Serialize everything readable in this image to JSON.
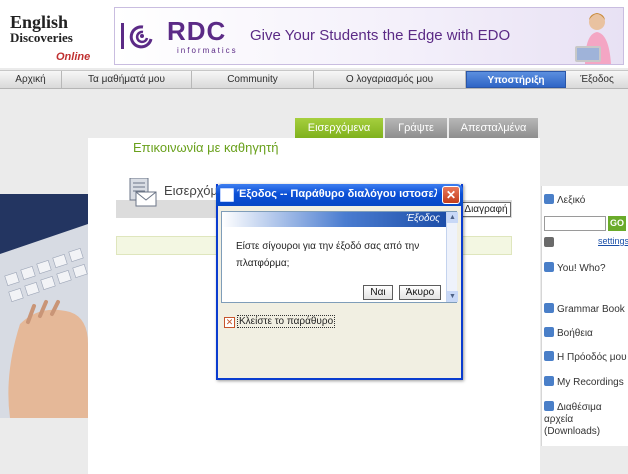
{
  "header": {
    "logo": {
      "line1": "English",
      "line2": "Discoveries",
      "online": "Online"
    },
    "banner": {
      "brand": "RDC",
      "brand_sub": "informatics",
      "slogan": "Give Your Students the Edge with EDO"
    }
  },
  "nav": {
    "items": [
      "Αρχική",
      "Τα μαθήματά μου",
      "Community",
      "Ο λογαριασμός μου",
      "Υποστήριξη",
      "Έξοδος"
    ],
    "active_index": 4
  },
  "tabs": [
    "Εισερχόμενα",
    "Γράψτε",
    "Απεσταλμένα"
  ],
  "page_title": "Επικοινωνία με καθηγητή",
  "inbox": {
    "label": "Εισερχόμενα",
    "delete_label": "Διαγραφή"
  },
  "sidebar": {
    "dictionary": "Λεξικό",
    "go": "GO",
    "settings": "settings",
    "you_who": "You! Who?",
    "grammar": "Grammar Book",
    "help": "Βοήθεια",
    "progress": "Η Πρόοδός μου",
    "recordings": "My Recordings",
    "downloads": "Διαθέσιμα αρχεία (Downloads)"
  },
  "dialog": {
    "title": "Έξοδος -- Παράθυρο διαλόγου ιστοσελί...",
    "header": "Έξοδος",
    "message": "Είστε σίγουροι για την έξοδό σας από την πλατφόρμα;",
    "yes": "Ναι",
    "cancel": "Άκυρο",
    "close_link": "Κλείστε το παράθυρο"
  }
}
